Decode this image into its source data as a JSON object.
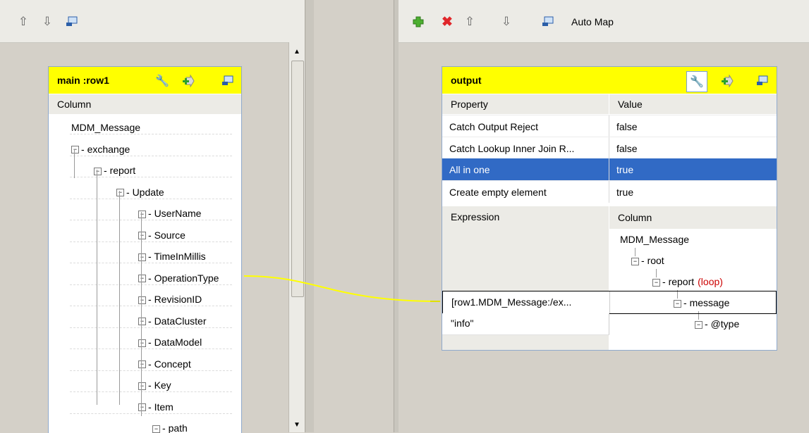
{
  "left": {
    "toolbar": {
      "up_icon": "arrow-up-icon",
      "down_icon": "arrow-down-icon",
      "minimize_icon": "minimize-icon"
    },
    "table": {
      "title": "main :row1",
      "column_header": "Column",
      "tree": [
        {
          "label": "MDM_Message",
          "depth": 0
        },
        {
          "label": "exchange",
          "depth": 1
        },
        {
          "label": "report",
          "depth": 2
        },
        {
          "label": "Update",
          "depth": 3
        },
        {
          "label": "UserName",
          "depth": 4
        },
        {
          "label": "Source",
          "depth": 4
        },
        {
          "label": "TimeInMillis",
          "depth": 4
        },
        {
          "label": "OperationType",
          "depth": 4
        },
        {
          "label": "RevisionID",
          "depth": 4
        },
        {
          "label": "DataCluster",
          "depth": 4
        },
        {
          "label": "DataModel",
          "depth": 4
        },
        {
          "label": "Concept",
          "depth": 4
        },
        {
          "label": "Key",
          "depth": 4
        },
        {
          "label": "Item",
          "depth": 4
        },
        {
          "label": "path",
          "depth": 5
        }
      ]
    }
  },
  "right": {
    "toolbar": {
      "add_icon": "plus-icon",
      "remove_icon": "delete-icon",
      "up_icon": "arrow-up-icon",
      "down_icon": "arrow-down-icon",
      "automap_label": "Auto Map"
    },
    "table": {
      "title": "output",
      "headers": {
        "property": "Property",
        "value": "Value",
        "expression": "Expression",
        "column": "Column"
      },
      "properties": [
        {
          "property": "Catch Output Reject",
          "value": "false",
          "selected": false
        },
        {
          "property": "Catch Lookup Inner Join R...",
          "value": "false",
          "selected": false
        },
        {
          "property": "All in one",
          "value": "true",
          "selected": true
        },
        {
          "property": "Create empty element",
          "value": "true",
          "selected": false
        }
      ],
      "tree": [
        {
          "label": "MDM_Message",
          "depth": 0
        },
        {
          "label": "root",
          "depth": 1
        },
        {
          "label": "report",
          "depth": 2,
          "tag": "(loop)"
        },
        {
          "label": "message",
          "depth": 3
        },
        {
          "label": "@type",
          "depth": 4
        }
      ],
      "expressions": [
        "[row1.MDM_Message:/ex...",
        "\"info\""
      ]
    }
  },
  "colors": {
    "header_yellow": "#ffff00",
    "selection": "#316ac5",
    "link_line": "#ffff00",
    "loop_tag": "#cc0000"
  }
}
